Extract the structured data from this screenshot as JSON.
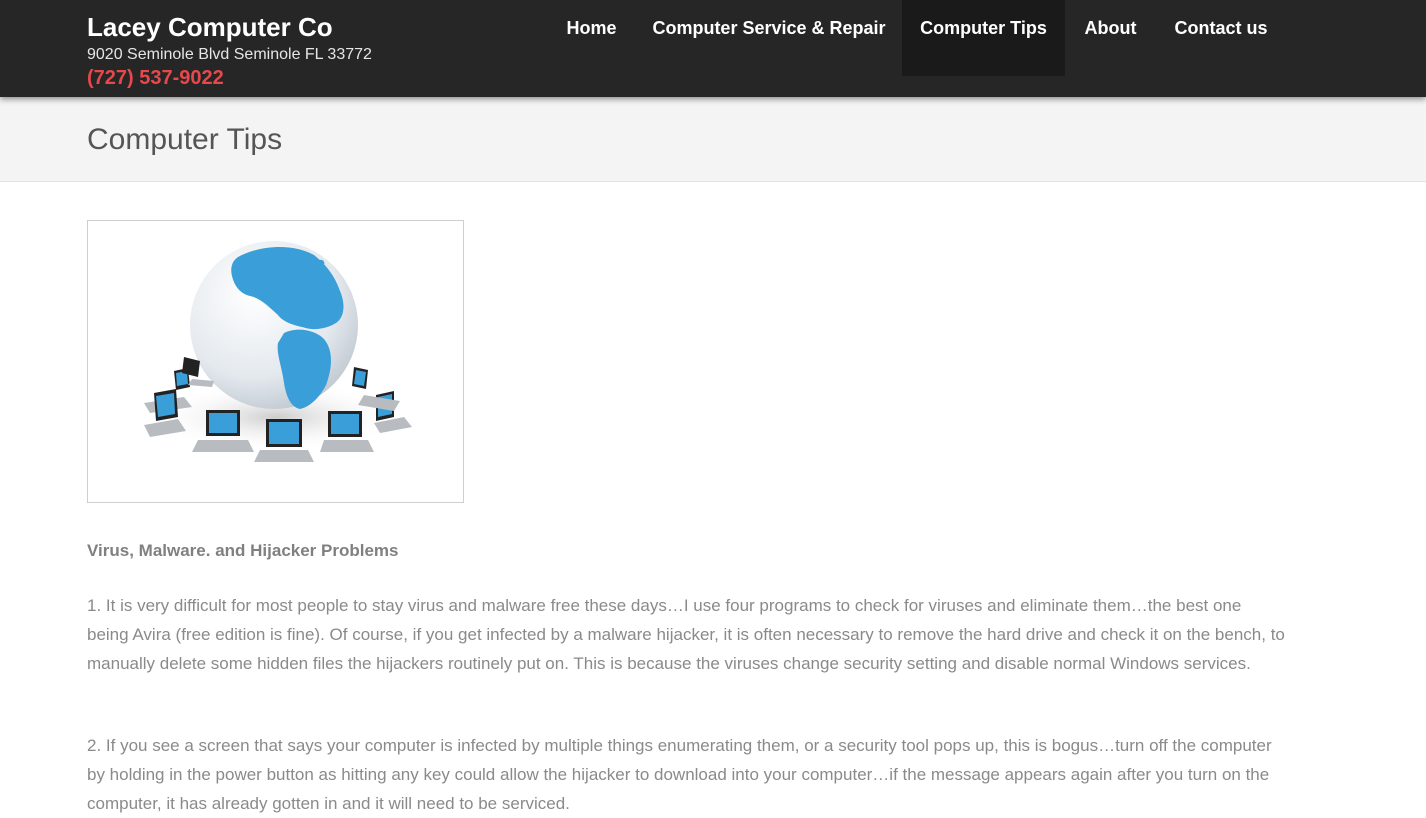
{
  "header": {
    "site_title": "Lacey Computer Co",
    "address": "9020 Seminole Blvd Seminole FL 33772",
    "phone": "(727) 537-9022"
  },
  "nav": {
    "items": [
      {
        "label": "Home",
        "active": false
      },
      {
        "label": "Computer Service & Repair",
        "active": false
      },
      {
        "label": "Computer Tips",
        "active": true
      },
      {
        "label": "About",
        "active": false
      },
      {
        "label": "Contact us",
        "active": false
      }
    ]
  },
  "page": {
    "title": "Computer Tips"
  },
  "article": {
    "heading": "Virus, Malware. and Hijacker Problems",
    "paragraphs": [
      "1. It is very difficult for most people to stay virus and malware free these days…I use four programs to check for viruses and eliminate them…the best one being Avira (free edition is fine). Of course, if you get infected by a malware hijacker, it is often necessary to remove the hard drive and check it on the bench, to manually delete some hidden files the hijackers routinely put on. This is because the viruses change security setting and disable normal Windows services.",
      "2. If you see a screen that says your computer is infected by multiple things enumerating them, or a security tool pops up, this is bogus…turn off the computer by holding in the power button as hitting any key could allow the hijacker to download into your computer…if the message appears again after you turn on the computer, it has already gotten in and it will need to be serviced."
    ]
  },
  "colors": {
    "header_bg": "#262626",
    "active_nav_bg": "#1a1a1a",
    "phone": "#e8484a",
    "globe_ocean": "#eef2f6",
    "globe_land": "#3a9fd8"
  }
}
